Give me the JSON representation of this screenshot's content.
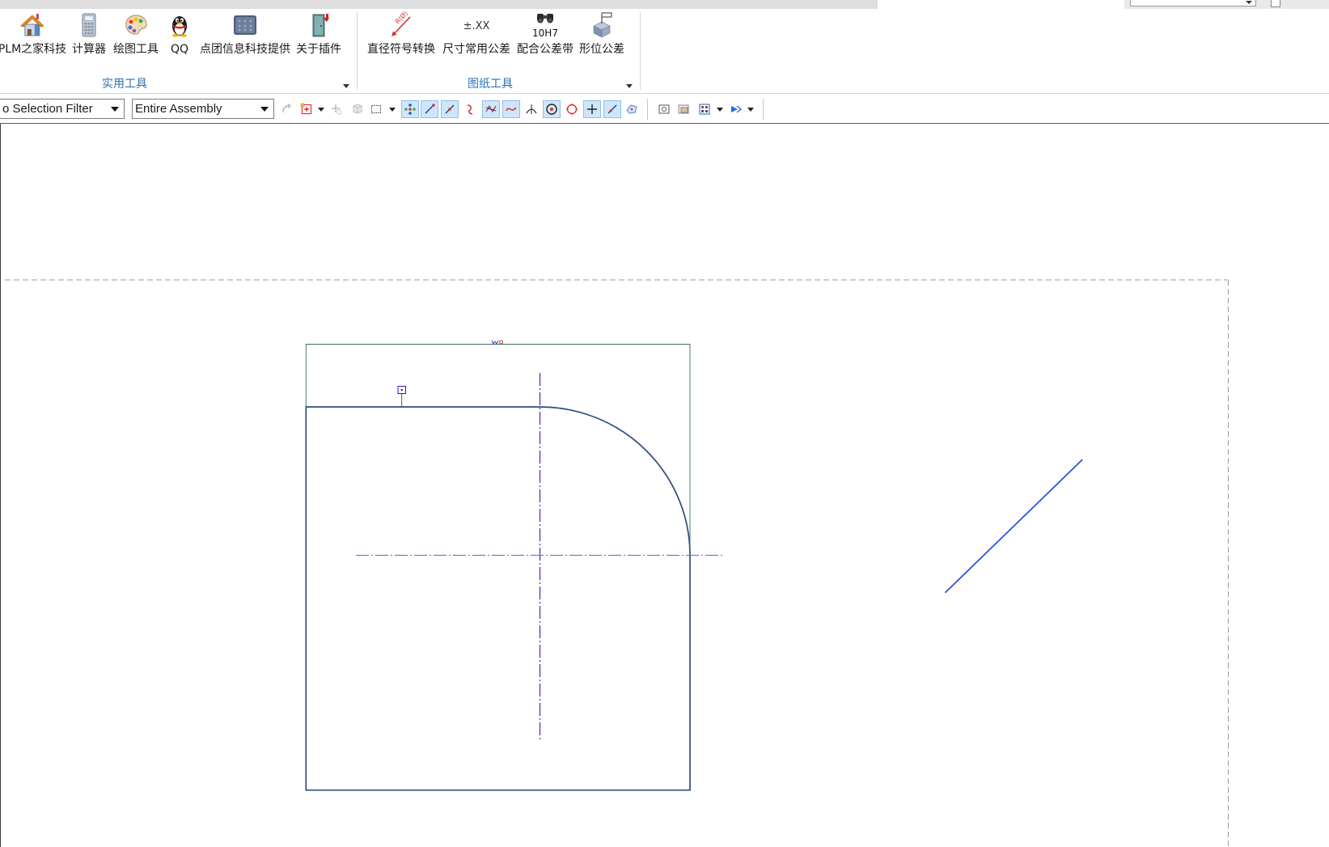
{
  "ribbon": {
    "groups": [
      {
        "label": "实用工具",
        "items": [
          {
            "label": "PLM之家科技",
            "icon": "house-icon"
          },
          {
            "label": "计算器",
            "icon": "calculator-icon"
          },
          {
            "label": "绘图工具",
            "icon": "palette-icon"
          },
          {
            "label": "QQ",
            "icon": "qq-penguin-icon"
          },
          {
            "label": "点团信息科技提供",
            "icon": "info-panel-icon"
          },
          {
            "label": "关于插件",
            "icon": "plugin-door-icon"
          }
        ]
      },
      {
        "label": "图纸工具",
        "items": [
          {
            "label": "直径符号转换",
            "icon": "diameter-symbol-icon",
            "icon_text": "R(Ø)"
          },
          {
            "label": "尺寸常用公差",
            "icon": "tolerance-text-icon",
            "icon_text": "±.XX"
          },
          {
            "label": "配合公差带",
            "icon": "fit-tolerance-icon",
            "icon_text": "10H7"
          },
          {
            "label": "形位公差",
            "icon": "geometric-tolerance-icon"
          }
        ]
      }
    ]
  },
  "toolbar": {
    "selection_filter": "o Selection Filter",
    "selection_scope": "Entire Assembly",
    "icons": [
      {
        "name": "type-filter-icon",
        "active": false
      },
      {
        "name": "add-selection-icon",
        "active": false
      },
      {
        "name": "select-feature-icon",
        "active": false
      },
      {
        "name": "select-body-icon",
        "active": false
      },
      {
        "name": "rectangle-select-icon",
        "active": false
      },
      {
        "name": "snap-enable-icon",
        "active": true
      },
      {
        "name": "snap-end-point-icon",
        "active": true
      },
      {
        "name": "snap-mid-point-icon",
        "active": true
      },
      {
        "name": "snap-control-point-icon",
        "active": false
      },
      {
        "name": "snap-intersection-icon",
        "active": true
      },
      {
        "name": "snap-curve-icon",
        "active": true
      },
      {
        "name": "snap-tangent-icon",
        "active": false
      },
      {
        "name": "snap-arc-center-icon",
        "active": true
      },
      {
        "name": "snap-quadrant-icon",
        "active": false
      },
      {
        "name": "snap-existing-point-icon",
        "active": true
      },
      {
        "name": "snap-point-on-curve-icon",
        "active": true
      },
      {
        "name": "snap-point-on-surface-icon",
        "active": false
      },
      {
        "name": "view-orient-icon",
        "active": false
      },
      {
        "name": "view-section-icon",
        "active": false
      },
      {
        "name": "view-layout-icon",
        "active": false
      },
      {
        "name": "render-style-icon",
        "active": false
      }
    ]
  },
  "colors": {
    "group_label": "#2c70b4",
    "sketch_profile": "#2d4e80",
    "centerline": "#3a3ad0",
    "construction_line": "#2a4ae0",
    "active_toolbar_bg": "#cfe6fa"
  }
}
